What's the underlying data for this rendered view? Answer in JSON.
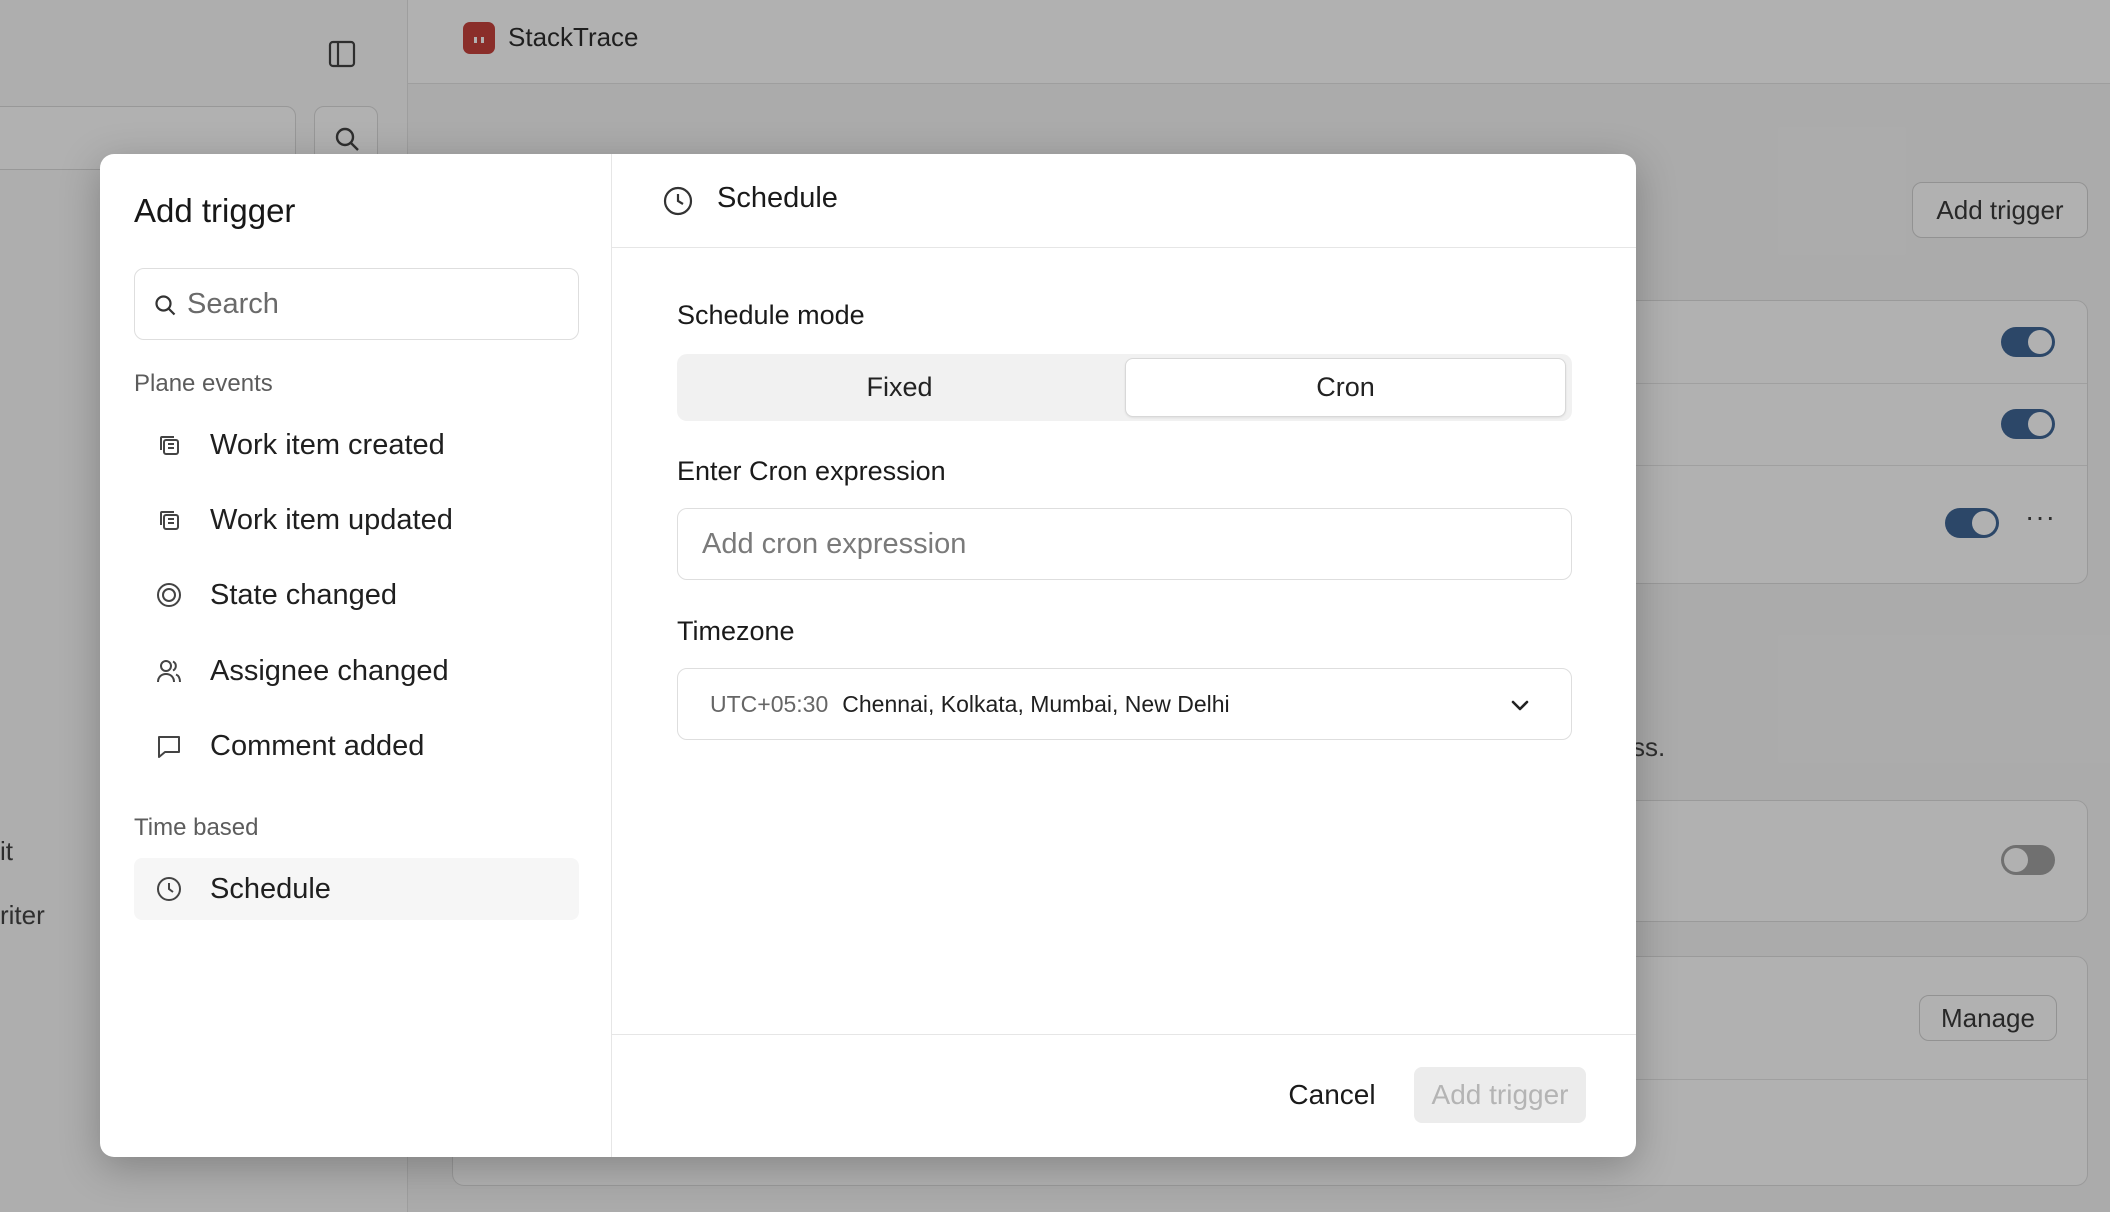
{
  "app": {
    "brand": "StackTrace"
  },
  "background": {
    "add_trigger_label": "Add trigger",
    "manage_label": "Manage",
    "more_label": "···",
    "partial_text_1": "ss.",
    "partial_text_2": "it",
    "partial_text_3": "riter",
    "toggles": [
      {
        "name": "toggle-1",
        "on": true
      },
      {
        "name": "toggle-2",
        "on": true
      },
      {
        "name": "toggle-3",
        "on": true
      },
      {
        "name": "toggle-4",
        "on": false
      }
    ]
  },
  "modal": {
    "title": "Add trigger",
    "search": {
      "placeholder": "Search"
    },
    "sections": {
      "plane_events": {
        "label": "Plane events",
        "items": [
          {
            "label": "Work item created",
            "icon": "work-items-icon"
          },
          {
            "label": "Work item updated",
            "icon": "work-items-icon"
          },
          {
            "label": "State changed",
            "icon": "state-icon"
          },
          {
            "label": "Assignee changed",
            "icon": "users-icon"
          },
          {
            "label": "Comment added",
            "icon": "comment-icon"
          }
        ]
      },
      "time_based": {
        "label": "Time based",
        "items": [
          {
            "label": "Schedule",
            "icon": "clock-icon",
            "active": true
          }
        ]
      }
    },
    "detail": {
      "title": "Schedule",
      "schedule_mode_label": "Schedule mode",
      "mode_options": [
        "Fixed",
        "Cron"
      ],
      "selected_mode": "Cron",
      "cron_label": "Enter Cron expression",
      "cron_placeholder": "Add cron expression",
      "cron_value": "",
      "timezone_label": "Timezone",
      "timezone": {
        "offset": "UTC+05:30",
        "cities": "Chennai, Kolkata, Mumbai, New Delhi"
      }
    },
    "footer": {
      "cancel_label": "Cancel",
      "submit_label": "Add trigger",
      "submit_disabled": true
    }
  },
  "colors": {
    "accent_toggle": "#2f5a8e",
    "logo": "#c2332d"
  }
}
